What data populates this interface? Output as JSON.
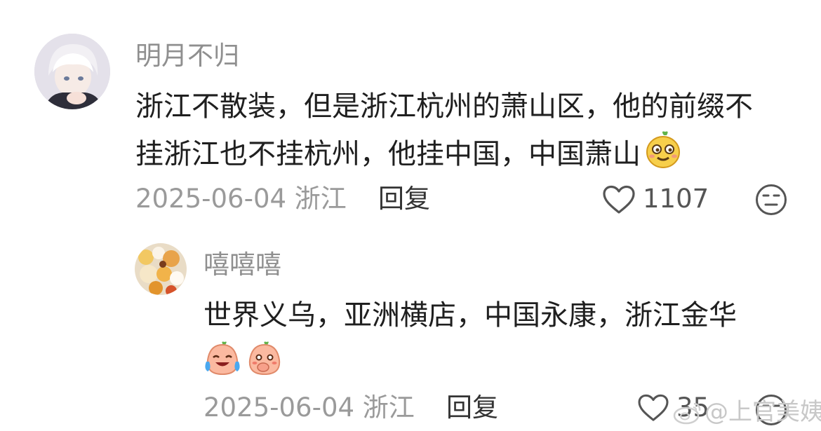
{
  "comments": [
    {
      "username": "明月不归",
      "text_line1": "浙江不散装，但是浙江杭州的萧山区，他的前缀不",
      "text_line2": "挂浙江也不挂杭州，他挂中国，中国萧山",
      "date": "2025-06-04",
      "location": "浙江",
      "reply_label": "回复",
      "likes": "1107",
      "avatar_icon": "anime-avatar",
      "inline_emoji_icon": "smug-face-emoji"
    },
    {
      "username": "嘻嘻嘻",
      "text_line1": "世界义乌，亚洲横店，中国永康，浙江金华",
      "date": "2025-06-04",
      "location": "浙江",
      "reply_label": "回复",
      "likes": "35",
      "avatar_icon": "food-avatar",
      "emojis": [
        "laugh-cry-emoji",
        "giggle-emoji"
      ]
    }
  ],
  "watermark": {
    "text": "@上官美姨",
    "icon": "weibo-icon"
  }
}
